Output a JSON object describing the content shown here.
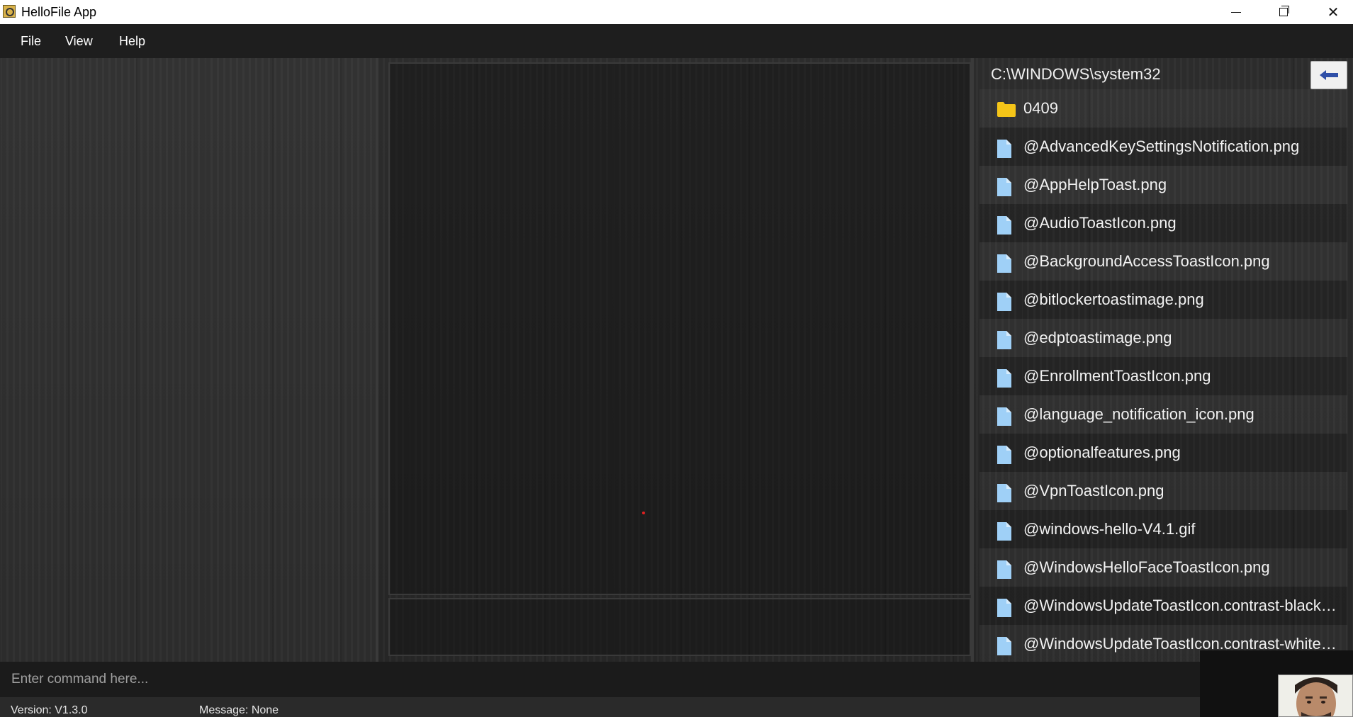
{
  "window": {
    "title": "HelloFile App",
    "icon": "magnifier-app-icon"
  },
  "menu": {
    "items": [
      {
        "label": "File"
      },
      {
        "label": "View"
      },
      {
        "label": "Help"
      }
    ]
  },
  "file_browser": {
    "path": "C:\\WINDOWS\\system32",
    "back_icon": "arrow-left-icon",
    "items": [
      {
        "name": "0409",
        "type": "folder"
      },
      {
        "name": "@AdvancedKeySettingsNotification.png",
        "type": "file"
      },
      {
        "name": "@AppHelpToast.png",
        "type": "file"
      },
      {
        "name": "@AudioToastIcon.png",
        "type": "file"
      },
      {
        "name": "@BackgroundAccessToastIcon.png",
        "type": "file"
      },
      {
        "name": "@bitlockertoastimage.png",
        "type": "file"
      },
      {
        "name": "@edptoastimage.png",
        "type": "file"
      },
      {
        "name": "@EnrollmentToastIcon.png",
        "type": "file"
      },
      {
        "name": "@language_notification_icon.png",
        "type": "file"
      },
      {
        "name": "@optionalfeatures.png",
        "type": "file"
      },
      {
        "name": "@VpnToastIcon.png",
        "type": "file"
      },
      {
        "name": "@windows-hello-V4.1.gif",
        "type": "file"
      },
      {
        "name": "@WindowsHelloFaceToastIcon.png",
        "type": "file"
      },
      {
        "name": "@WindowsUpdateToastIcon.contrast-black.png",
        "type": "file"
      },
      {
        "name": "@WindowsUpdateToastIcon.contrast-white.png",
        "type": "file"
      }
    ]
  },
  "command": {
    "placeholder": "Enter command here...",
    "value": ""
  },
  "status": {
    "version": "Version:  V1.3.0",
    "message": "Message:  None"
  },
  "colors": {
    "background": "#2b2b2b",
    "folder": "#f5c518",
    "file": "#9fd0f7",
    "back_arrow": "#2f4fa8"
  }
}
